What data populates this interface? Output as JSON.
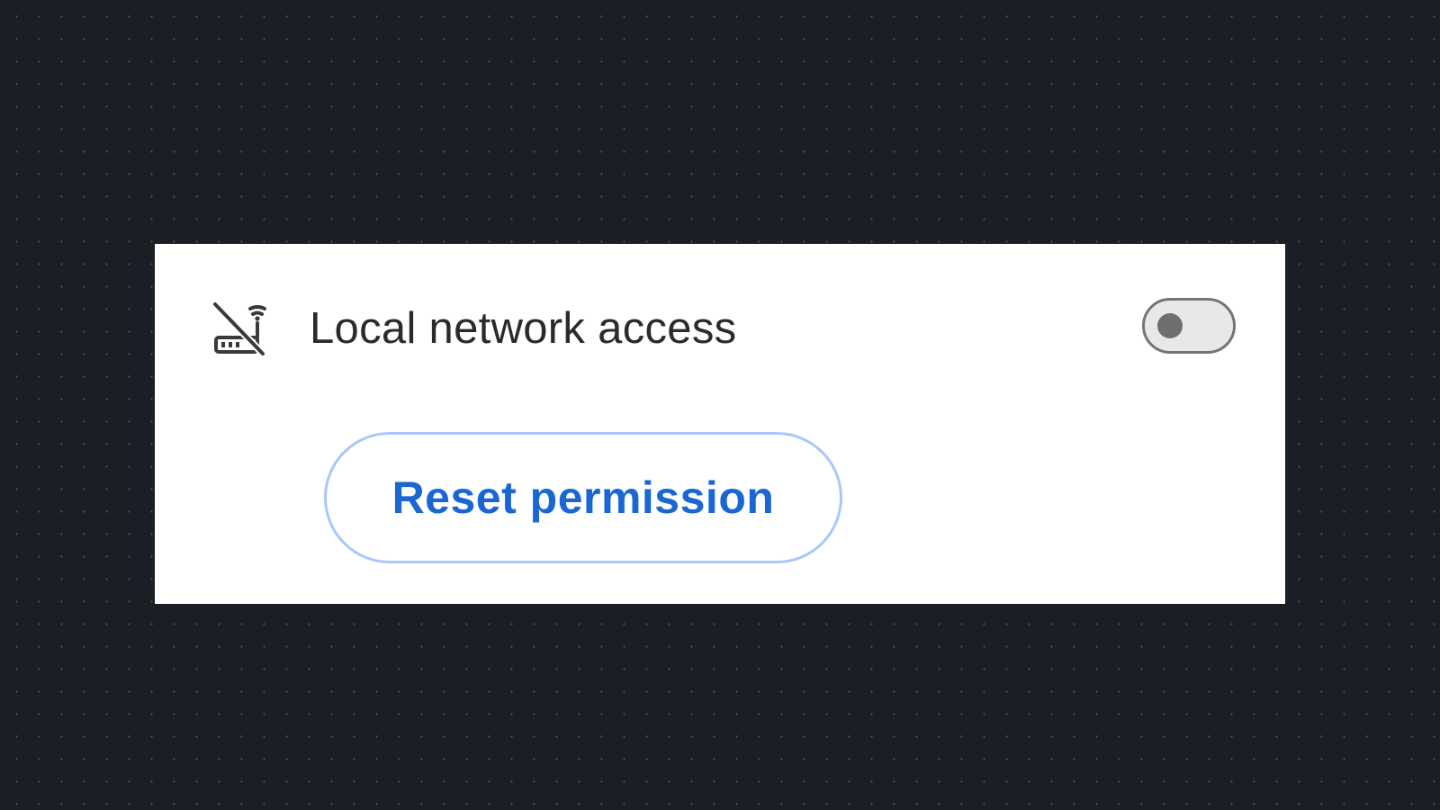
{
  "permission": {
    "label": "Local network access",
    "icon": "local-network-off-icon",
    "toggle_state": "off"
  },
  "actions": {
    "reset_label": "Reset permission"
  },
  "colors": {
    "background": "#1b1e24",
    "panel": "#ffffff",
    "text": "#2b2b2b",
    "accent": "#1a66d2",
    "button_border": "#a8c7fa",
    "toggle_track": "#e8e8e6",
    "toggle_border": "#757575"
  }
}
